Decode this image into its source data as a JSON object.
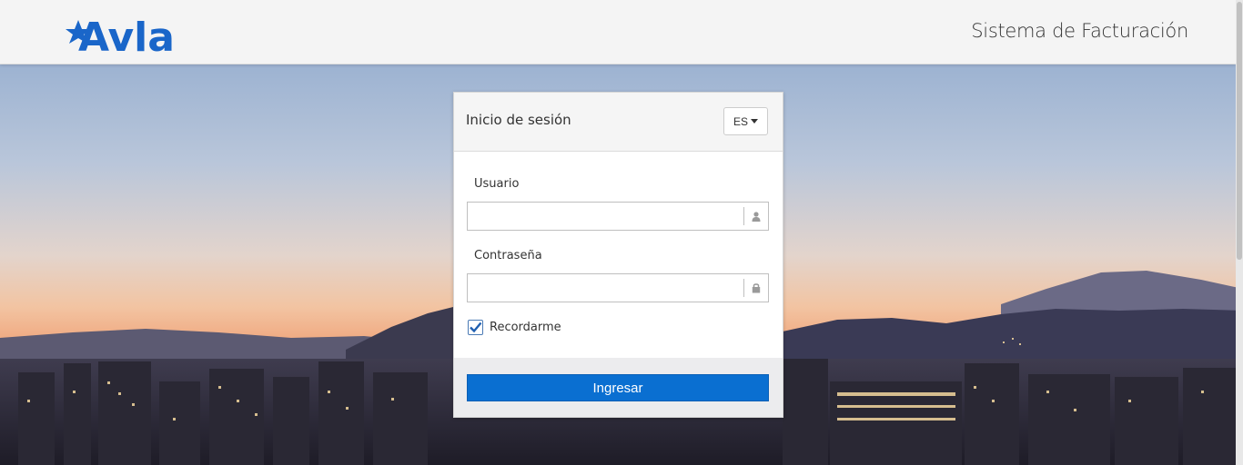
{
  "header": {
    "brand": "Avla",
    "system_title": "Sistema de Facturación",
    "brand_color": "#1a66c9"
  },
  "login": {
    "title": "Inicio de sesión",
    "language": "ES",
    "username_label": "Usuario",
    "username_value": "",
    "password_label": "Contraseña",
    "password_value": "",
    "remember_label": "Recordarme",
    "remember_checked": true,
    "submit_label": "Ingresar",
    "submit_color": "#0a6fd1"
  },
  "icons": {
    "username": "user-icon",
    "password": "lock-icon",
    "remember": "checkmark-icon"
  }
}
